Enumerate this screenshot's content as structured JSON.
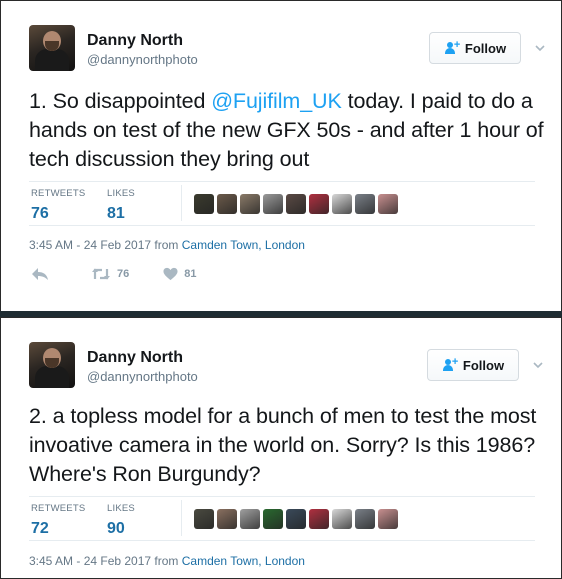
{
  "colors": {
    "accent": "#1da1f2",
    "link": "#1d6fa5",
    "muted": "#657786",
    "icon": "#aab8c2"
  },
  "tweets": [
    {
      "author": {
        "name": "Danny North",
        "handle": "@dannynorthphoto"
      },
      "follow_label": "Follow",
      "text_before": "1. So disappointed ",
      "mention": "@Fujifilm_UK",
      "text_after": " today. I paid to do a hands on test of the new GFX 50s - and after 1 hour of tech discussion they bring out",
      "stats": {
        "retweets_label": "RETWEETS",
        "retweets": "76",
        "likes_label": "LIKES",
        "likes": "81"
      },
      "timestamp": "3:45 AM - 24 Feb 2017 from ",
      "location": "Camden Town, London",
      "actions": {
        "reply_icon": "reply-icon",
        "retweet_count": "76",
        "like_count": "81"
      },
      "liker_colors": [
        "#3b3b2e",
        "#6b5a4a",
        "#8a7a68",
        "#9a9a9a",
        "#5a4a44",
        "#b03040",
        "#d8d8d8",
        "#7a8088",
        "#c89090"
      ]
    },
    {
      "author": {
        "name": "Danny North",
        "handle": "@dannynorthphoto"
      },
      "follow_label": "Follow",
      "text": "2. a topless model for a bunch of men to test the most invoative camera in the world on. Sorry? Is this 1986? Where's Ron Burgundy?",
      "stats": {
        "retweets_label": "RETWEETS",
        "retweets": "72",
        "likes_label": "LIKES",
        "likes": "90"
      },
      "timestamp": "3:45 AM - 24 Feb 2017 from ",
      "location": "Camden Town, London",
      "liker_colors": [
        "#4a4a40",
        "#8a7060",
        "#a0a0a0",
        "#2a6a30",
        "#3a4a5a",
        "#b03040",
        "#d8d8d8",
        "#7a8088",
        "#c89090"
      ]
    }
  ]
}
